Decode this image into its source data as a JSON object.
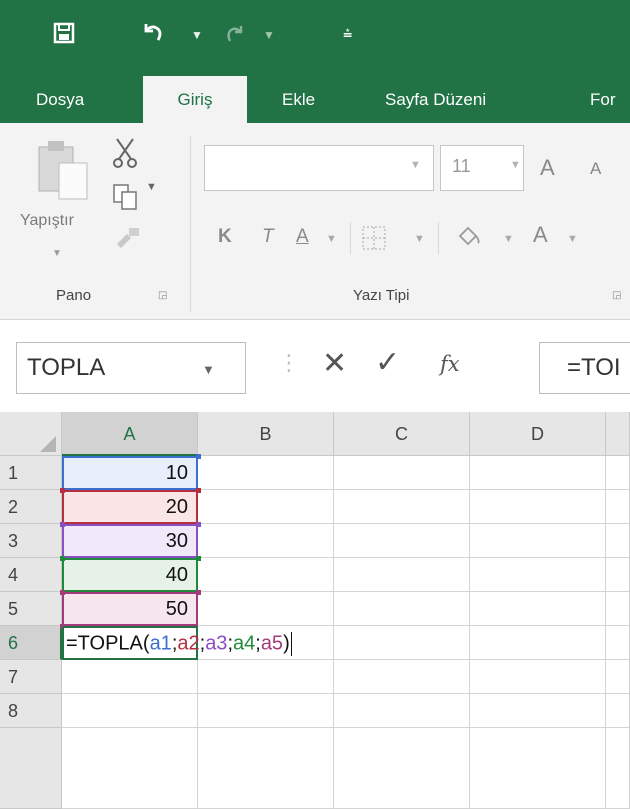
{
  "tabs": {
    "dosya": "Dosya",
    "giris": "Giriş",
    "ekle": "Ekle",
    "sayfa_duzeni": "Sayfa Düzeni",
    "formuller": "For"
  },
  "ribbon": {
    "paste_label": "Yapıştır",
    "clipboard_group": "Pano",
    "font_group": "Yazı Tipi",
    "font_size": "11",
    "bold": "K",
    "italic": "T",
    "underline": "A",
    "font_color": "A",
    "grow_font": "A",
    "shrink_font": "A"
  },
  "formula_bar": {
    "name_box": "TOPLA",
    "formula": "=TOI",
    "fx": "fx"
  },
  "grid": {
    "columns": [
      "A",
      "B",
      "C",
      "D"
    ],
    "rows": [
      "1",
      "2",
      "3",
      "4",
      "5",
      "6",
      "7",
      "8"
    ],
    "a_values": [
      "10",
      "20",
      "30",
      "40",
      "50"
    ],
    "editing": {
      "prefix": "=TOPLA(",
      "refs": [
        "a1",
        "a2",
        "a3",
        "a4",
        "a5"
      ],
      "separator": ";",
      "suffix": ")"
    }
  },
  "colors": {
    "accent": "#217346",
    "ref_a1": "#3b6fd0",
    "ref_a2": "#b5303e",
    "ref_a3": "#8b4fc4",
    "ref_a4": "#1f8a3c",
    "ref_a5": "#a33a7b"
  },
  "icons": [
    "save-icon",
    "undo-icon",
    "redo-icon",
    "customize-icon",
    "paste-icon",
    "cut-icon",
    "copy-icon",
    "format-painter-icon",
    "borders-icon",
    "fill-color-icon",
    "cancel-icon",
    "enter-icon",
    "insert-function-icon"
  ]
}
